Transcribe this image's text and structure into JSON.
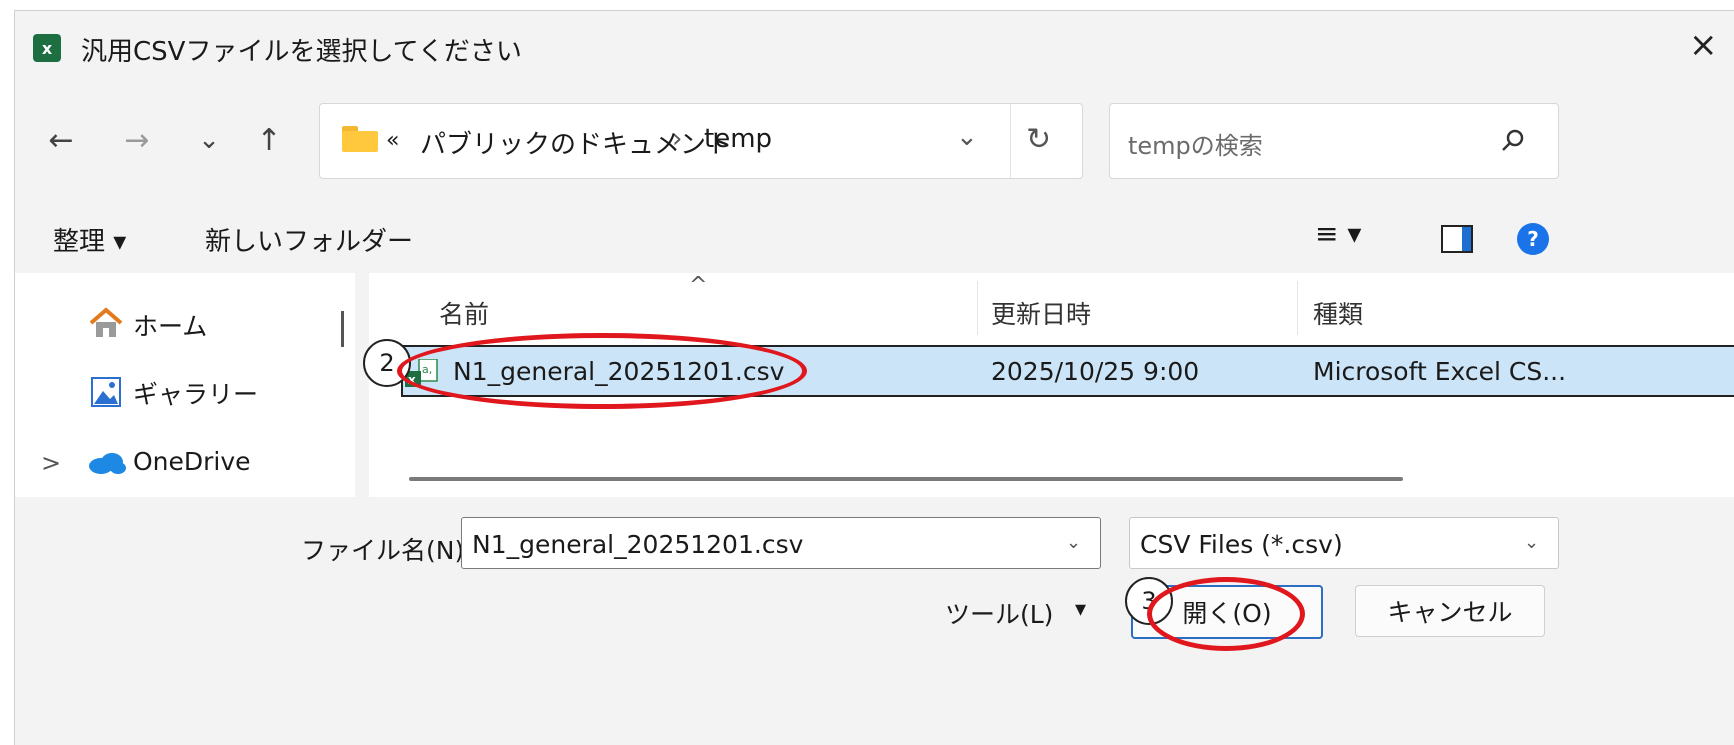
{
  "dialog": {
    "title": "汎用CSVファイルを選択してください",
    "app_icon_text": "x",
    "close_glyph": "×"
  },
  "nav": {
    "back": "←",
    "forward": "→",
    "recent": "⌄",
    "up": "↑"
  },
  "address": {
    "overflow": "«",
    "crumbs": [
      "パブリックのドキュメント",
      "temp"
    ],
    "separator": "›",
    "dropdown": "⌄",
    "refresh": "↻"
  },
  "search": {
    "placeholder": "tempの検索",
    "icon": "search-icon"
  },
  "toolbar": {
    "organize": "整理 ▾",
    "new_folder": "新しいフォルダー",
    "view_menu": "≡ ▾",
    "help": "?"
  },
  "sidebar": {
    "items": [
      {
        "label": "ホーム",
        "icon": "home-icon"
      },
      {
        "label": "ギャラリー",
        "icon": "gallery-icon"
      },
      {
        "label": "OneDrive",
        "icon": "cloud-icon",
        "expander": ">"
      }
    ]
  },
  "file_list": {
    "sort_arrow": "^",
    "columns": [
      "名前",
      "更新日時",
      "種類"
    ],
    "rows": [
      {
        "name": "N1_general_20251201.csv",
        "modified": "2025/10/25 9:00",
        "type": "Microsoft Excel CS..."
      }
    ]
  },
  "bottom": {
    "filename_label": "ファイル名(N):",
    "filename_value": "N1_general_20251201.csv",
    "filetype_value": "CSV Files (*.csv)",
    "tools_label": "ツール(L)",
    "tools_arrow": "▾",
    "open_button": "開く(O)",
    "cancel_button": "キャンセル",
    "dropdown": "⌄"
  },
  "annotations": {
    "callout_2": "2",
    "callout_3": "3",
    "ring_color": "#e0181e"
  }
}
